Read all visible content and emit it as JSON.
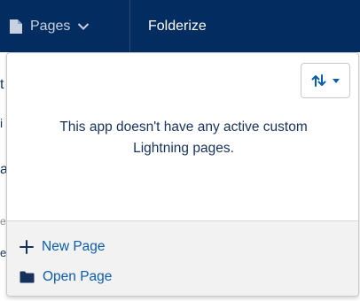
{
  "nav": {
    "pages_label": "Pages",
    "app_name": "Folderize"
  },
  "background": {
    "fragments": [
      "t",
      "i",
      "a",
      "e",
      "e"
    ]
  },
  "panel": {
    "empty_message": "This app doesn't have any active custom Lightning pages.",
    "footer": {
      "new_page": "New Page",
      "open_page": "Open Page"
    }
  },
  "colors": {
    "nav_bg": "#032d60",
    "link_blue": "#0b5cab",
    "text_dark": "#16325c",
    "footer_bg": "#f3f2f2"
  }
}
